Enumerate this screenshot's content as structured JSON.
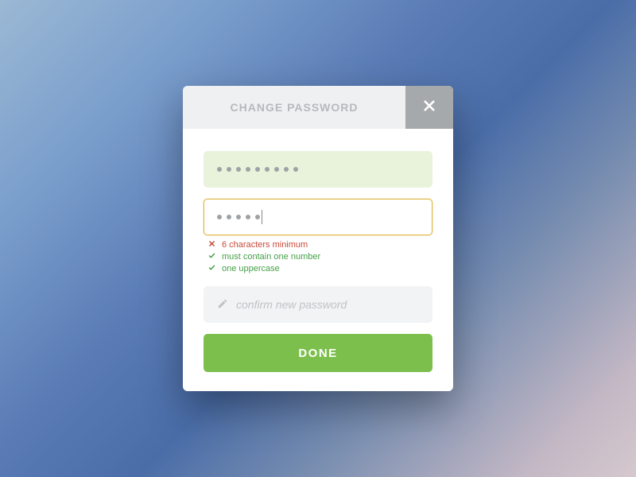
{
  "header": {
    "title": "CHANGE PASSWORD"
  },
  "fields": {
    "current": {
      "filled_dots": 9
    },
    "new": {
      "filled_dots": 5
    },
    "confirm": {
      "placeholder": "confirm new password"
    }
  },
  "rules": [
    {
      "ok": false,
      "text": "6 characters minimum"
    },
    {
      "ok": true,
      "text": "must contain one number"
    },
    {
      "ok": true,
      "text": "one uppercase"
    }
  ],
  "actions": {
    "submit_label": "DONE"
  },
  "colors": {
    "accent": "#7cbf4d",
    "warn": "#c84a3a",
    "ok": "#45a047",
    "active_border": "#e0b74a"
  }
}
